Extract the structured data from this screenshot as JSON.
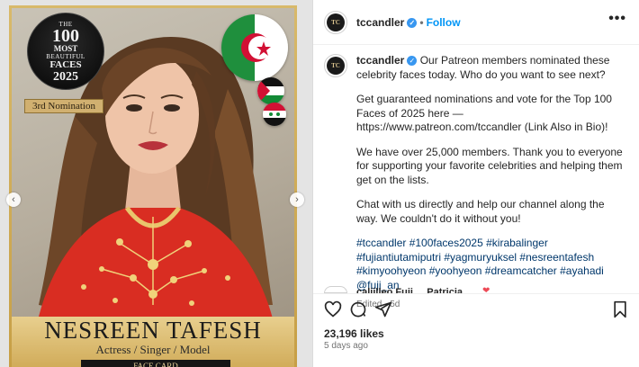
{
  "media": {
    "badge": {
      "line1": "THE",
      "line2": "100",
      "line3": "MOST",
      "line4": "BEAUTIFUL",
      "line5": "FACES",
      "line6": "2025"
    },
    "nomination": "3rd Nomination",
    "name": "NESREEN TAFESH",
    "roles": "Actress / Singer / Model",
    "facecard": "FACE CARD",
    "flags": [
      "algeria-flag",
      "palestine-flag",
      "syria-flag"
    ],
    "prev_icon": "chevron-left-icon",
    "next_icon": "chevron-right-icon"
  },
  "header": {
    "username": "tccandler",
    "verified_icon": "verified-badge-icon",
    "separator": "•",
    "follow_label": "Follow",
    "more_icon": "more-options-icon"
  },
  "caption": {
    "username": "tccandler",
    "p1": "Our Patreon members nominated these celebrity faces today. Who do you want to see next?",
    "p2": "Get guaranteed nominations and vote for the Top 100 Faces of 2025 here — https://www.patreon.com/tccandler (Link Also in Bio)!",
    "p3": "We have over 25,000 members. Thank you to everyone for supporting your favorite celebrities and helping them get on the lists.",
    "p4": "Chat with us directly and help our channel along the way. We couldn't do it without you!",
    "hashtags": "#tccandler #100faces2025 #kirabalinger #fujiantiutamiputri #yagmuryuksel #nesreentafesh #kimyoohyeon #yoohyeon #dreamcatcher #ayahadi @fuji_an",
    "edited": "Edited · 5d"
  },
  "comment_peek": "caliilleo  Fuji ... Patricia",
  "actions": {
    "like_icon": "heart-icon",
    "comment_icon": "comment-icon",
    "share_icon": "share-icon",
    "save_icon": "bookmark-icon"
  },
  "likes": "23,196 likes",
  "time_ago": "5 days ago",
  "colors": {
    "link": "#0095f6",
    "hashtag": "#00376b",
    "gold": "#d1ac5a",
    "dress": "#d92d22"
  }
}
